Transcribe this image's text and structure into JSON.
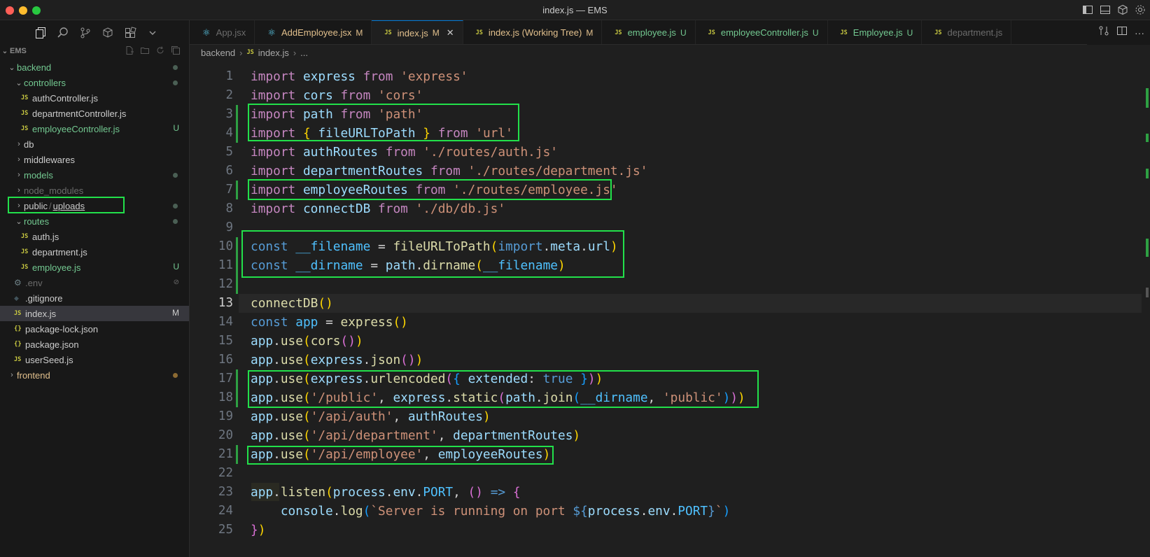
{
  "window": {
    "title": "index.js — EMS"
  },
  "explorer": {
    "root": "EMS",
    "items": [
      {
        "label": "backend",
        "kind": "folder-open",
        "depth": 0,
        "color": "green",
        "marker": "dot"
      },
      {
        "label": "controllers",
        "kind": "folder-open",
        "depth": 1,
        "color": "green",
        "marker": "dot"
      },
      {
        "label": "authController.js",
        "kind": "js",
        "depth": 2,
        "color": "default",
        "marker": ""
      },
      {
        "label": "departmentController.js",
        "kind": "js",
        "depth": 2,
        "color": "default",
        "marker": ""
      },
      {
        "label": "employeeController.js",
        "kind": "js",
        "depth": 2,
        "color": "green",
        "marker": "U"
      },
      {
        "label": "db",
        "kind": "folder",
        "depth": 1,
        "color": "default",
        "marker": ""
      },
      {
        "label": "middlewares",
        "kind": "folder",
        "depth": 1,
        "color": "default",
        "marker": ""
      },
      {
        "label": "models",
        "kind": "folder",
        "depth": 1,
        "color": "green",
        "marker": "dot"
      },
      {
        "label": "node_modules",
        "kind": "folder",
        "depth": 1,
        "color": "dim",
        "marker": ""
      },
      {
        "label": "public",
        "label2": "uploads",
        "kind": "folder",
        "depth": 1,
        "color": "default",
        "marker": "dot"
      },
      {
        "label": "routes",
        "kind": "folder-open",
        "depth": 1,
        "color": "green",
        "marker": "dot"
      },
      {
        "label": "auth.js",
        "kind": "js",
        "depth": 2,
        "color": "default",
        "marker": ""
      },
      {
        "label": "department.js",
        "kind": "js",
        "depth": 2,
        "color": "default",
        "marker": ""
      },
      {
        "label": "employee.js",
        "kind": "js",
        "depth": 2,
        "color": "green",
        "marker": "U"
      },
      {
        "label": ".env",
        "kind": "gear",
        "depth": 1,
        "color": "dim",
        "marker": "ignored"
      },
      {
        "label": ".gitignore",
        "kind": "git",
        "depth": 1,
        "color": "default",
        "marker": ""
      },
      {
        "label": "index.js",
        "kind": "js",
        "depth": 1,
        "color": "default",
        "marker": "M",
        "selected": true
      },
      {
        "label": "package-lock.json",
        "kind": "json",
        "depth": 1,
        "color": "default",
        "marker": ""
      },
      {
        "label": "package.json",
        "kind": "json",
        "depth": 1,
        "color": "default",
        "marker": ""
      },
      {
        "label": "userSeed.js",
        "kind": "js",
        "depth": 1,
        "color": "default",
        "marker": ""
      },
      {
        "label": "frontend",
        "kind": "folder",
        "depth": 0,
        "color": "orange",
        "marker": "dot-orange"
      }
    ]
  },
  "tabs": [
    {
      "label": "App.jsx",
      "icon": "react",
      "status": "",
      "color": "#6b6b6b"
    },
    {
      "label": "AddEmployee.jsx",
      "icon": "react",
      "status": "M",
      "color": "#e2c08d"
    },
    {
      "label": "index.js",
      "icon": "js",
      "status": "M",
      "color": "#e2c08d",
      "active": true
    },
    {
      "label": "index.js (Working Tree)",
      "icon": "js",
      "status": "M",
      "color": "#e2c08d"
    },
    {
      "label": "employee.js",
      "icon": "js",
      "status": "U",
      "color": "#73c991"
    },
    {
      "label": "employeeController.js",
      "icon": "js",
      "status": "U",
      "color": "#73c991"
    },
    {
      "label": "Employee.js",
      "icon": "js",
      "status": "U",
      "color": "#73c991"
    },
    {
      "label": "department.js",
      "icon": "js",
      "status": "",
      "color": "#6b6b6b"
    }
  ],
  "breadcrumb": {
    "folder": "backend",
    "file": "index.js",
    "more": "..."
  },
  "editor": {
    "current_line": 13,
    "lines": [
      [
        [
          "kw",
          "import"
        ],
        [
          "pl",
          " "
        ],
        [
          "id",
          "express"
        ],
        [
          "pl",
          " "
        ],
        [
          "kw",
          "from"
        ],
        [
          "pl",
          " "
        ],
        [
          "str",
          "'express'"
        ]
      ],
      [
        [
          "kw",
          "import"
        ],
        [
          "pl",
          " "
        ],
        [
          "id",
          "cors"
        ],
        [
          "pl",
          " "
        ],
        [
          "kw",
          "from"
        ],
        [
          "pl",
          " "
        ],
        [
          "str",
          "'cors'"
        ]
      ],
      [
        [
          "kw",
          "import"
        ],
        [
          "pl",
          " "
        ],
        [
          "id",
          "path"
        ],
        [
          "pl",
          " "
        ],
        [
          "kw",
          "from"
        ],
        [
          "pl",
          " "
        ],
        [
          "str",
          "'path'"
        ]
      ],
      [
        [
          "kw",
          "import"
        ],
        [
          "pl",
          " "
        ],
        [
          "br1",
          "{"
        ],
        [
          "pl",
          " "
        ],
        [
          "id",
          "fileURLToPath"
        ],
        [
          "pl",
          " "
        ],
        [
          "br1",
          "}"
        ],
        [
          "pl",
          " "
        ],
        [
          "kw",
          "from"
        ],
        [
          "pl",
          " "
        ],
        [
          "str",
          "'url'"
        ]
      ],
      [
        [
          "kw",
          "import"
        ],
        [
          "pl",
          " "
        ],
        [
          "id",
          "authRoutes"
        ],
        [
          "pl",
          " "
        ],
        [
          "kw",
          "from"
        ],
        [
          "pl",
          " "
        ],
        [
          "str",
          "'./routes/auth.js'"
        ]
      ],
      [
        [
          "kw",
          "import"
        ],
        [
          "pl",
          " "
        ],
        [
          "id",
          "departmentRoutes"
        ],
        [
          "pl",
          " "
        ],
        [
          "kw",
          "from"
        ],
        [
          "pl",
          " "
        ],
        [
          "str",
          "'./routes/department.js'"
        ]
      ],
      [
        [
          "kw",
          "import"
        ],
        [
          "pl",
          " "
        ],
        [
          "id",
          "employeeRoutes"
        ],
        [
          "pl",
          " "
        ],
        [
          "kw",
          "from"
        ],
        [
          "pl",
          " "
        ],
        [
          "str",
          "'./routes/employee.js'"
        ]
      ],
      [
        [
          "kw",
          "import"
        ],
        [
          "pl",
          " "
        ],
        [
          "id",
          "connectDB"
        ],
        [
          "pl",
          " "
        ],
        [
          "kw",
          "from"
        ],
        [
          "pl",
          " "
        ],
        [
          "str",
          "'./db/db.js'"
        ]
      ],
      [],
      [
        [
          "kw2",
          "const"
        ],
        [
          "pl",
          " "
        ],
        [
          "cn",
          "__filename"
        ],
        [
          "pl",
          " = "
        ],
        [
          "fn",
          "fileURLToPath"
        ],
        [
          "br1",
          "("
        ],
        [
          "kw2",
          "import"
        ],
        [
          "pl",
          "."
        ],
        [
          "id",
          "meta"
        ],
        [
          "pl",
          "."
        ],
        [
          "id",
          "url"
        ],
        [
          "br1",
          ")"
        ]
      ],
      [
        [
          "kw2",
          "const"
        ],
        [
          "pl",
          " "
        ],
        [
          "cn",
          "__dirname"
        ],
        [
          "pl",
          " = "
        ],
        [
          "id",
          "path"
        ],
        [
          "pl",
          "."
        ],
        [
          "fn",
          "dirname"
        ],
        [
          "br1",
          "("
        ],
        [
          "cn",
          "__filename"
        ],
        [
          "br1",
          ")"
        ]
      ],
      [],
      [
        [
          "fn",
          "connectDB"
        ],
        [
          "br1",
          "()"
        ]
      ],
      [
        [
          "kw2",
          "const"
        ],
        [
          "pl",
          " "
        ],
        [
          "cn",
          "app"
        ],
        [
          "pl",
          " = "
        ],
        [
          "fn",
          "express"
        ],
        [
          "br1",
          "()"
        ]
      ],
      [
        [
          "id",
          "app"
        ],
        [
          "pl",
          "."
        ],
        [
          "fn",
          "use"
        ],
        [
          "br1",
          "("
        ],
        [
          "fn",
          "cors"
        ],
        [
          "br2",
          "()"
        ],
        [
          "br1",
          ")"
        ]
      ],
      [
        [
          "id",
          "app"
        ],
        [
          "pl",
          "."
        ],
        [
          "fn",
          "use"
        ],
        [
          "br1",
          "("
        ],
        [
          "id",
          "express"
        ],
        [
          "pl",
          "."
        ],
        [
          "fn",
          "json"
        ],
        [
          "br2",
          "()"
        ],
        [
          "br1",
          ")"
        ]
      ],
      [
        [
          "id",
          "app"
        ],
        [
          "pl",
          "."
        ],
        [
          "fn",
          "use"
        ],
        [
          "br1",
          "("
        ],
        [
          "id",
          "express"
        ],
        [
          "pl",
          "."
        ],
        [
          "fn",
          "urlencoded"
        ],
        [
          "br2",
          "("
        ],
        [
          "br3",
          "{"
        ],
        [
          "pl",
          " "
        ],
        [
          "id",
          "extended"
        ],
        [
          "pl",
          ": "
        ],
        [
          "kw2",
          "true"
        ],
        [
          "pl",
          " "
        ],
        [
          "br3",
          "}"
        ],
        [
          "br2",
          ")"
        ],
        [
          "br1",
          ")"
        ]
      ],
      [
        [
          "id",
          "app"
        ],
        [
          "pl",
          "."
        ],
        [
          "fn",
          "use"
        ],
        [
          "br1",
          "("
        ],
        [
          "str",
          "'/public'"
        ],
        [
          "pl",
          ", "
        ],
        [
          "id",
          "express"
        ],
        [
          "pl",
          "."
        ],
        [
          "fn",
          "static"
        ],
        [
          "br2",
          "("
        ],
        [
          "id",
          "path"
        ],
        [
          "pl",
          "."
        ],
        [
          "fn",
          "join"
        ],
        [
          "br3",
          "("
        ],
        [
          "cn",
          "__dirname"
        ],
        [
          "pl",
          ", "
        ],
        [
          "str",
          "'public'"
        ],
        [
          "br3",
          ")"
        ],
        [
          "br2",
          ")"
        ],
        [
          "br1",
          ")"
        ]
      ],
      [
        [
          "id",
          "app"
        ],
        [
          "pl",
          "."
        ],
        [
          "fn",
          "use"
        ],
        [
          "br1",
          "("
        ],
        [
          "str",
          "'/api/auth'"
        ],
        [
          "pl",
          ", "
        ],
        [
          "id",
          "authRoutes"
        ],
        [
          "br1",
          ")"
        ]
      ],
      [
        [
          "id",
          "app"
        ],
        [
          "pl",
          "."
        ],
        [
          "fn",
          "use"
        ],
        [
          "br1",
          "("
        ],
        [
          "str",
          "'/api/department'"
        ],
        [
          "pl",
          ", "
        ],
        [
          "id",
          "departmentRoutes"
        ],
        [
          "br1",
          ")"
        ]
      ],
      [
        [
          "id",
          "app"
        ],
        [
          "pl",
          "."
        ],
        [
          "fn",
          "use"
        ],
        [
          "br1",
          "("
        ],
        [
          "str",
          "'/api/employee'"
        ],
        [
          "pl",
          ", "
        ],
        [
          "id",
          "employeeRoutes"
        ],
        [
          "br1",
          ")"
        ]
      ],
      [],
      [
        [
          "id",
          "app"
        ],
        [
          "pl",
          "."
        ],
        [
          "fn",
          "listen"
        ],
        [
          "br1",
          "("
        ],
        [
          "id",
          "process"
        ],
        [
          "pl",
          "."
        ],
        [
          "id",
          "env"
        ],
        [
          "pl",
          "."
        ],
        [
          "cn",
          "PORT"
        ],
        [
          "pl",
          ", "
        ],
        [
          "br2",
          "()"
        ],
        [
          "pl",
          " "
        ],
        [
          "kw2",
          "=>"
        ],
        [
          "pl",
          " "
        ],
        [
          "br2",
          "{"
        ]
      ],
      [
        [
          "pl",
          "    "
        ],
        [
          "id",
          "console"
        ],
        [
          "pl",
          "."
        ],
        [
          "fn",
          "log"
        ],
        [
          "br3",
          "("
        ],
        [
          "str",
          "`Server is running on port "
        ],
        [
          "kw2",
          "${"
        ],
        [
          "id",
          "process"
        ],
        [
          "pl",
          "."
        ],
        [
          "id",
          "env"
        ],
        [
          "pl",
          "."
        ],
        [
          "cn",
          "PORT"
        ],
        [
          "kw2",
          "}"
        ],
        [
          "str",
          "`"
        ],
        [
          "br3",
          ")"
        ]
      ],
      [
        [
          "br2",
          "}"
        ],
        [
          "br1",
          ")"
        ]
      ]
    ]
  }
}
